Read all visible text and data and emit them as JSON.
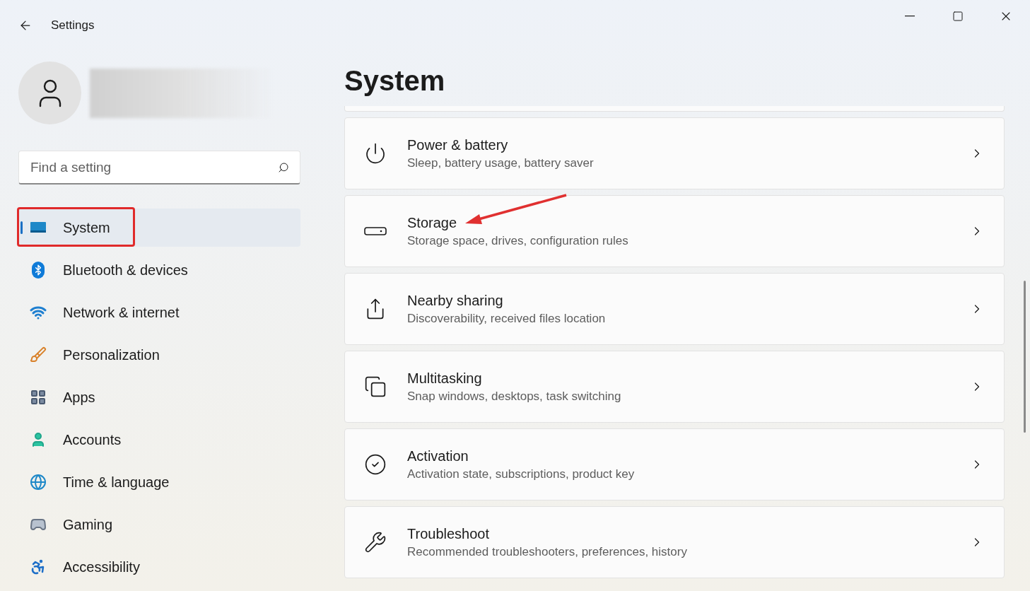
{
  "window": {
    "title": "Settings"
  },
  "search": {
    "placeholder": "Find a setting"
  },
  "nav": [
    {
      "label": "System",
      "kind": "system",
      "selected": true,
      "highlighted": true
    },
    {
      "label": "Bluetooth & devices",
      "kind": "bluetooth",
      "selected": false,
      "highlighted": false
    },
    {
      "label": "Network & internet",
      "kind": "network",
      "selected": false,
      "highlighted": false
    },
    {
      "label": "Personalization",
      "kind": "brush",
      "selected": false,
      "highlighted": false
    },
    {
      "label": "Apps",
      "kind": "apps",
      "selected": false,
      "highlighted": false
    },
    {
      "label": "Accounts",
      "kind": "accounts",
      "selected": false,
      "highlighted": false
    },
    {
      "label": "Time & language",
      "kind": "time",
      "selected": false,
      "highlighted": false
    },
    {
      "label": "Gaming",
      "kind": "gaming",
      "selected": false,
      "highlighted": false
    },
    {
      "label": "Accessibility",
      "kind": "accessibility",
      "selected": false,
      "highlighted": false
    }
  ],
  "page_title": "System",
  "cards": [
    {
      "title": "Power & battery",
      "subtitle": "Sleep, battery usage, battery saver",
      "kind": "power",
      "pointed": false
    },
    {
      "title": "Storage",
      "subtitle": "Storage space, drives, configuration rules",
      "kind": "storage",
      "pointed": true
    },
    {
      "title": "Nearby sharing",
      "subtitle": "Discoverability, received files location",
      "kind": "share",
      "pointed": false
    },
    {
      "title": "Multitasking",
      "subtitle": "Snap windows, desktops, task switching",
      "kind": "multitask",
      "pointed": false
    },
    {
      "title": "Activation",
      "subtitle": "Activation state, subscriptions, product key",
      "kind": "activation",
      "pointed": false
    },
    {
      "title": "Troubleshoot",
      "subtitle": "Recommended troubleshooters, preferences, history",
      "kind": "troubleshoot",
      "pointed": false
    }
  ]
}
